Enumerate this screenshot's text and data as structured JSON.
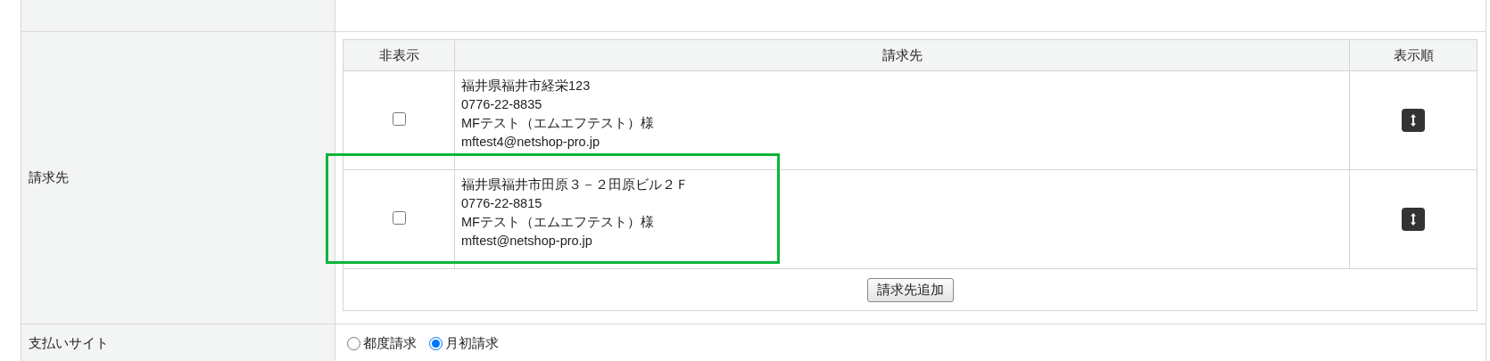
{
  "form_rows": [
    {
      "label": ""
    },
    {
      "label": "請求先",
      "billing_table": {
        "columns": [
          "非表示",
          "請求先",
          "表示順"
        ],
        "rows": [
          {
            "hidden": false,
            "lines": [
              "福井県福井市経栄123",
              "0776-22-8835",
              "MFテスト（エムエフテスト）様",
              "mftest4@netshop-pro.jp"
            ]
          },
          {
            "hidden": false,
            "lines": [
              "福井県福井市田原３－２田原ビル２Ｆ",
              "0776-22-8815",
              "MFテスト（エムエフテスト）様",
              "mftest@netshop-pro.jp"
            ]
          }
        ],
        "add_button": "請求先追加"
      }
    },
    {
      "label": "支払いサイト",
      "radios": [
        {
          "label": "都度請求",
          "selected": false
        },
        {
          "label": "月初請求",
          "selected": true
        }
      ]
    }
  ]
}
